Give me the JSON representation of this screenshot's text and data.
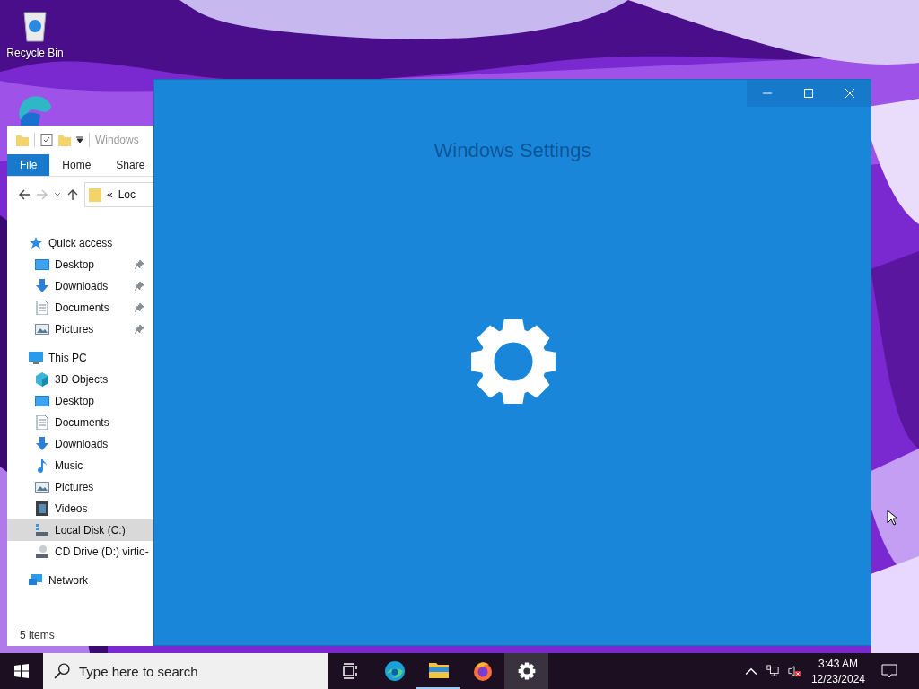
{
  "desktop_icons": [
    {
      "label": "Recycle Bin",
      "kind": "recycle-bin"
    }
  ],
  "explorer": {
    "title": "Windows",
    "ribbon_tabs": [
      {
        "label": "File",
        "selected": true
      },
      {
        "label": "Home",
        "selected": false
      },
      {
        "label": "Share",
        "selected": false
      }
    ],
    "address_chevron": "«",
    "address": "Loc",
    "nav": [
      {
        "label": "Quick access",
        "kind": "star",
        "selected": false,
        "children": [
          {
            "label": "Desktop",
            "kind": "desktop",
            "pinned": true,
            "selected": false
          },
          {
            "label": "Downloads",
            "kind": "downloads",
            "pinned": true,
            "selected": false
          },
          {
            "label": "Documents",
            "kind": "documents",
            "pinned": true,
            "selected": false
          },
          {
            "label": "Pictures",
            "kind": "pictures",
            "pinned": true,
            "selected": false
          }
        ]
      },
      {
        "label": "This PC",
        "kind": "pc",
        "selected": false,
        "children": [
          {
            "label": "3D Objects",
            "kind": "objects",
            "pinned": false,
            "selected": false
          },
          {
            "label": "Desktop",
            "kind": "desktop",
            "pinned": false,
            "selected": false
          },
          {
            "label": "Documents",
            "kind": "documents",
            "pinned": false,
            "selected": false
          },
          {
            "label": "Downloads",
            "kind": "downloads",
            "pinned": false,
            "selected": false
          },
          {
            "label": "Music",
            "kind": "music",
            "pinned": false,
            "selected": false
          },
          {
            "label": "Pictures",
            "kind": "pictures",
            "pinned": false,
            "selected": false
          },
          {
            "label": "Videos",
            "kind": "videos",
            "pinned": false,
            "selected": false
          },
          {
            "label": "Local Disk (C:)",
            "kind": "disk",
            "pinned": false,
            "selected": true
          },
          {
            "label": "CD Drive (D:) virtio-",
            "kind": "cd",
            "pinned": false,
            "selected": false
          }
        ]
      },
      {
        "label": "Network",
        "kind": "network",
        "selected": false
      }
    ],
    "status_bar": "5 items"
  },
  "settings_window": {
    "title": "Windows Settings"
  },
  "taskbar": {
    "search": {
      "placeholder": "Type here to search"
    },
    "apps": [
      {
        "kind": "task-view",
        "selected": false,
        "running": false
      },
      {
        "kind": "edge",
        "selected": false,
        "running": false
      },
      {
        "kind": "explorer",
        "selected": false,
        "running": true
      },
      {
        "kind": "firefox",
        "selected": false,
        "running": false
      },
      {
        "kind": "settings",
        "selected": true,
        "running": false
      }
    ],
    "volume_muted": true,
    "time": "3:43 AM",
    "date": "12/23/2024"
  }
}
